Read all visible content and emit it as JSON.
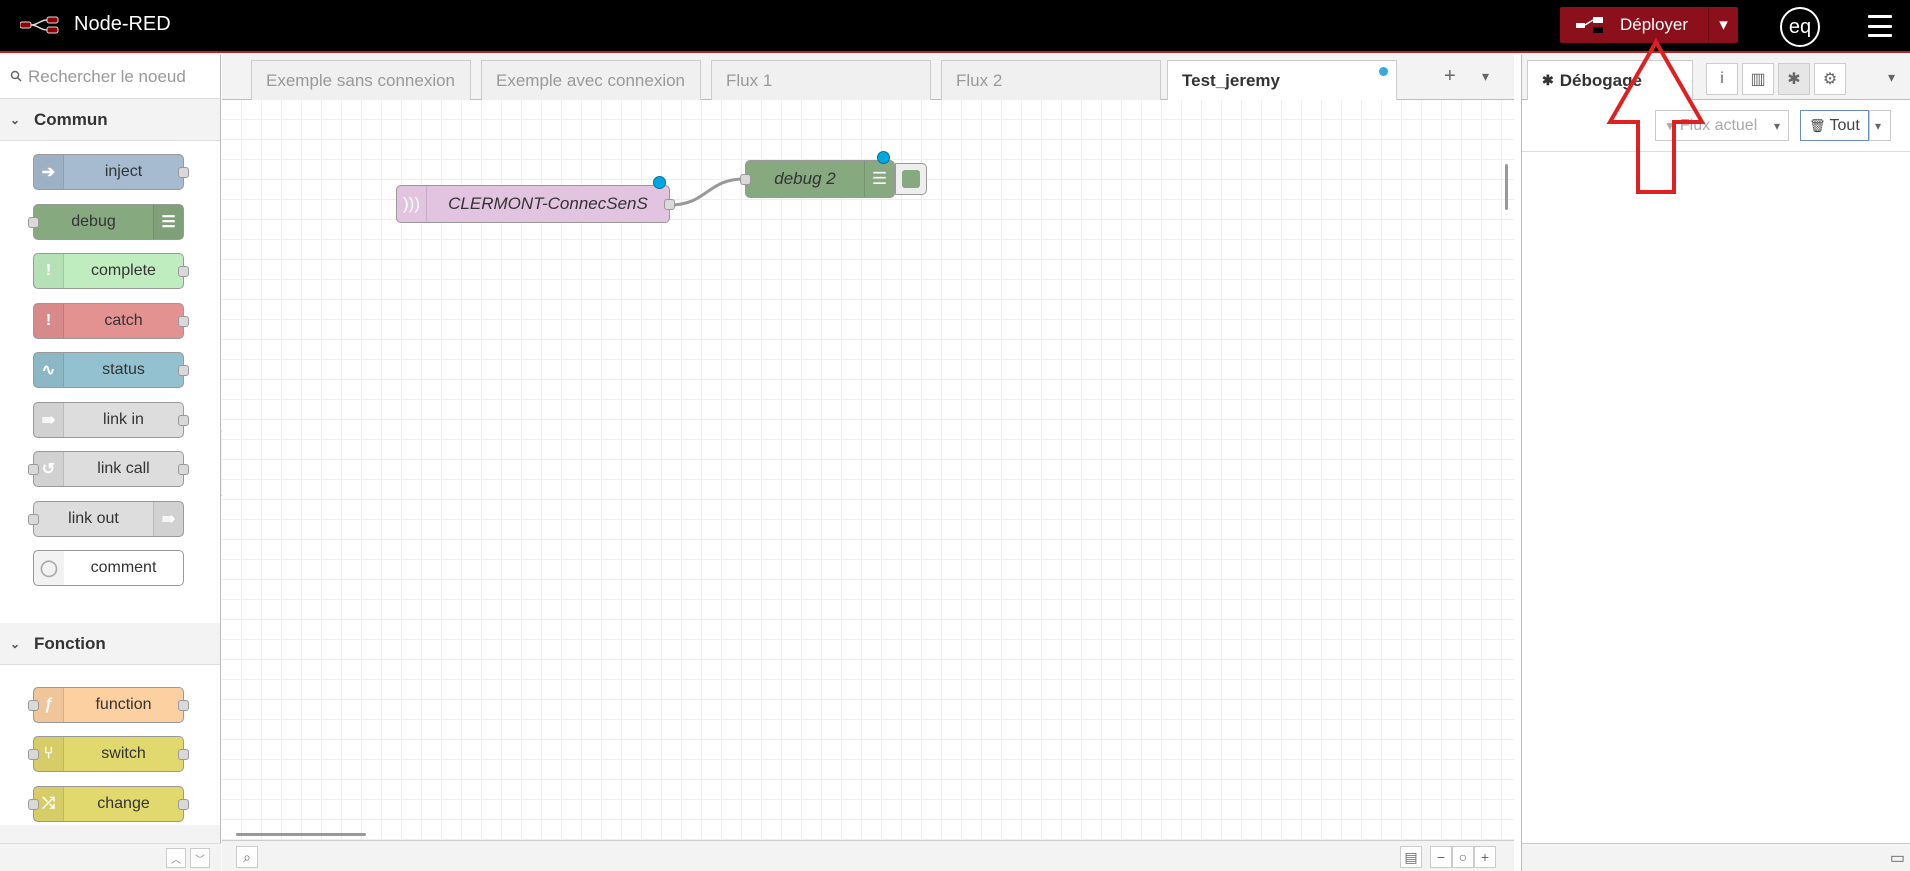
{
  "header": {
    "app_title": "Node-RED",
    "deploy_label": "Déployer",
    "user_initials": "eq",
    "logo_icon": "node-red-logo-icon",
    "menu_icon": "hamburger-menu-icon"
  },
  "palette": {
    "search_placeholder": "Rechercher le noeud",
    "categories": [
      {
        "label": "Commun",
        "nodes": [
          {
            "label": "inject",
            "icon": "arrow-in-icon",
            "color": "#a6bbcf"
          },
          {
            "label": "debug",
            "icon": "list-icon",
            "color": "#87a980"
          },
          {
            "label": "complete",
            "icon": "exclamation-icon",
            "color": "#c0edc0"
          },
          {
            "label": "catch",
            "icon": "exclamation-icon",
            "color": "#e49191"
          },
          {
            "label": "status",
            "icon": "pulse-icon",
            "color": "#94c1d0"
          },
          {
            "label": "link in",
            "icon": "link-in-icon",
            "color": "#dddddd"
          },
          {
            "label": "link call",
            "icon": "link-call-icon",
            "color": "#dddddd"
          },
          {
            "label": "link out",
            "icon": "link-out-icon",
            "color": "#dddddd"
          },
          {
            "label": "comment",
            "icon": "speech-bubble-icon",
            "color": "#ffffff"
          }
        ]
      },
      {
        "label": "Fonction",
        "nodes": [
          {
            "label": "function",
            "icon": "function-icon",
            "color": "#fdd0a2"
          },
          {
            "label": "switch",
            "icon": "switch-icon",
            "color": "#e2d96e"
          },
          {
            "label": "change",
            "icon": "shuffle-icon",
            "color": "#e2d96e"
          }
        ]
      }
    ]
  },
  "workspace": {
    "tabs": [
      {
        "label": "Exemple sans connexion"
      },
      {
        "label": "Exemple avec connexion"
      },
      {
        "label": "Flux 1"
      },
      {
        "label": "Flux 2"
      },
      {
        "label": "Test_jeremy"
      }
    ],
    "active_tab": "Test_jeremy",
    "flow_nodes": [
      {
        "label": "CLERMONT-ConnecSenS",
        "color": "#e2c4e0"
      },
      {
        "label": "debug 2",
        "color": "#87a980"
      }
    ]
  },
  "sidebar": {
    "active_tab_label": "Débogage",
    "filter_label": "Flux actuel",
    "clear_label": "Tout",
    "tab_icons": [
      "info-icon",
      "book-icon",
      "bug-icon",
      "gear-icon"
    ]
  },
  "colors": {
    "deploy_bg": "#8c101c",
    "header_bg": "#000000",
    "annotation_arrow": "#e02020",
    "changed_dot": "#00a7e1"
  }
}
